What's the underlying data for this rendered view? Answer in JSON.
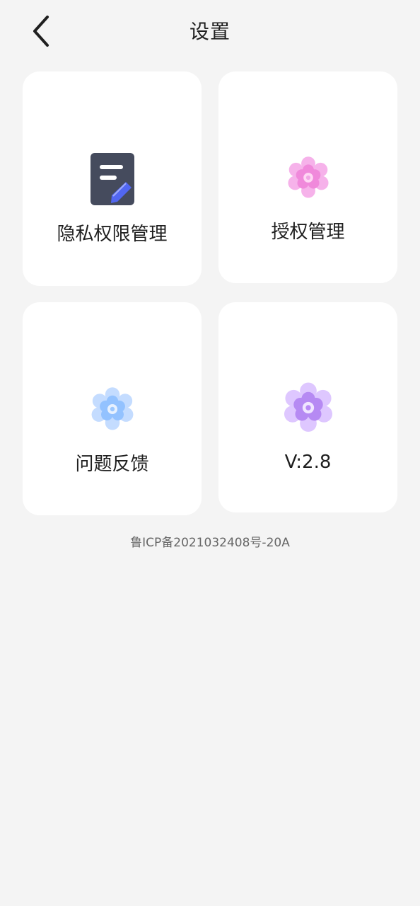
{
  "header": {
    "title": "设置"
  },
  "cards": {
    "privacy": {
      "label": "隐私权限管理",
      "icon": "document-edit-icon"
    },
    "authorization": {
      "label": "授权管理",
      "icon": "pink-flower-icon"
    },
    "feedback": {
      "label": "问题反馈",
      "icon": "blue-flower-icon"
    },
    "version": {
      "label": "V:2.8",
      "icon": "purple-flower-icon"
    }
  },
  "footer": {
    "icp": "鲁ICP备2021032408号-20A"
  },
  "colors": {
    "background": "#f4f4f4",
    "card": "#ffffff",
    "text": "#1f1f1f",
    "muted_text": "#666666",
    "doc_icon": "#454b5d",
    "pencil_icon": "#5267f1",
    "pink_flower": "#f089db",
    "blue_flower": "#93c2ff",
    "purple_flower": "#b68af3"
  }
}
